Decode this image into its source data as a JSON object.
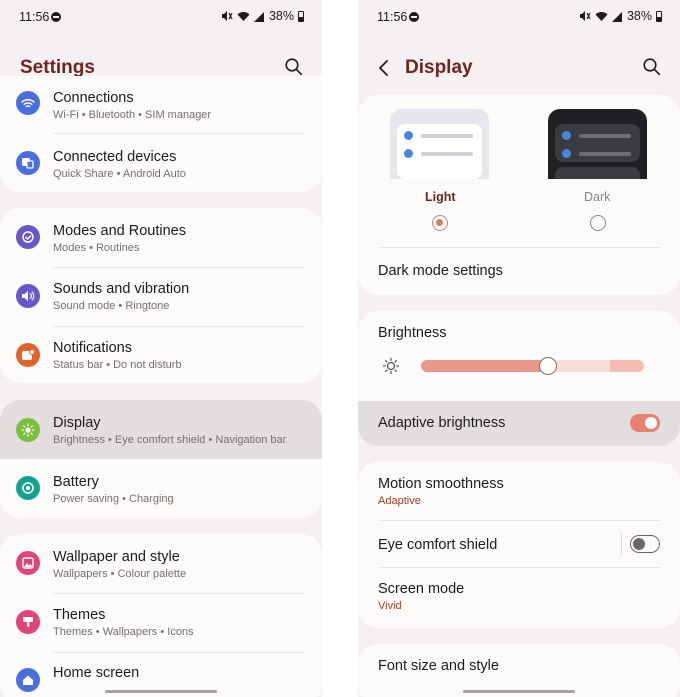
{
  "status_bar": {
    "time": "11:56",
    "battery": "38%"
  },
  "left": {
    "title": "Settings",
    "groups": [
      {
        "items": [
          {
            "id": "connections",
            "label": "Connections",
            "sub": "Wi-Fi  •  Bluetooth  •  SIM manager",
            "icon": "wifi-icon",
            "color": "#4a6ee0"
          },
          {
            "id": "connected-devices",
            "label": "Connected devices",
            "sub": "Quick Share  •  Android Auto",
            "icon": "devices-icon",
            "color": "#4a6ee0"
          }
        ]
      },
      {
        "items": [
          {
            "id": "modes-routines",
            "label": "Modes and Routines",
            "sub": "Modes  •  Routines",
            "icon": "check-circle-icon",
            "color": "#6a56c8"
          },
          {
            "id": "sounds-vibration",
            "label": "Sounds and vibration",
            "sub": "Sound mode  •  Ringtone",
            "icon": "speaker-icon",
            "color": "#6a56c8"
          },
          {
            "id": "notifications",
            "label": "Notifications",
            "sub": "Status bar  •  Do not disturb",
            "icon": "notification-icon",
            "color": "#e0622c"
          }
        ]
      },
      {
        "items": [
          {
            "id": "display",
            "label": "Display",
            "sub": "Brightness  •  Eye comfort shield  •  Navigation bar",
            "icon": "sun-icon",
            "color": "#7cbf3f",
            "selected": true
          },
          {
            "id": "battery",
            "label": "Battery",
            "sub": "Power saving  •  Charging",
            "icon": "battery-circle-icon",
            "color": "#17a08c"
          }
        ]
      },
      {
        "items": [
          {
            "id": "wallpaper-style",
            "label": "Wallpaper and style",
            "sub": "Wallpapers  •  Colour palette",
            "icon": "image-icon",
            "color": "#e0457a"
          },
          {
            "id": "themes",
            "label": "Themes",
            "sub": "Themes  •  Wallpapers  •  Icons",
            "icon": "brush-icon",
            "color": "#e0457a"
          },
          {
            "id": "home-screen",
            "label": "Home screen",
            "sub": "",
            "icon": "home-icon",
            "color": "#4a6ee0"
          }
        ]
      }
    ]
  },
  "right": {
    "title": "Display",
    "theme": {
      "light_label": "Light",
      "dark_label": "Dark",
      "selected": "light",
      "dark_mode_settings": "Dark mode settings"
    },
    "brightness": {
      "label": "Brightness",
      "value": 0.57
    },
    "adaptive_brightness": {
      "label": "Adaptive brightness",
      "on": true
    },
    "motion_smoothness": {
      "label": "Motion smoothness",
      "value": "Adaptive"
    },
    "eye_comfort": {
      "label": "Eye comfort shield",
      "on": false
    },
    "screen_mode": {
      "label": "Screen mode",
      "value": "Vivid"
    },
    "font": {
      "label": "Font size and style"
    }
  },
  "colors": {
    "accent": "#6d2424",
    "toggle_on": "#e8806e",
    "radio_selected": "#c9826f"
  }
}
